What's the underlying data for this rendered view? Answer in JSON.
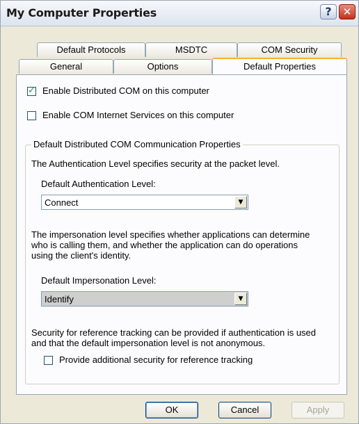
{
  "window": {
    "title": "My Computer Properties",
    "help_glyph": "?",
    "close_glyph": "✕"
  },
  "tabs_back": [
    {
      "label": "Default Protocols"
    },
    {
      "label": "MSDTC"
    },
    {
      "label": "COM Security"
    }
  ],
  "tabs_front": [
    {
      "label": "General"
    },
    {
      "label": "Options"
    },
    {
      "label": "Default Properties",
      "active": true
    }
  ],
  "panel": {
    "enable_dcom": {
      "label": "Enable Distributed COM on this computer",
      "checked": true
    },
    "enable_cis": {
      "label": "Enable COM Internet Services on this computer",
      "checked": false
    },
    "group": {
      "legend": "Default Distributed COM Communication Properties",
      "auth_desc": "The Authentication Level specifies security at the packet level.",
      "auth_label": "Default Authentication Level:",
      "auth_value": "Connect",
      "imp_desc_1": "The impersonation level specifies whether applications can determine",
      "imp_desc_2": "who is calling them, and whether the application can do operations",
      "imp_desc_3": "using the client's identity.",
      "imp_label": "Default Impersonation Level:",
      "imp_value": "Identify",
      "ref_desc_1": "Security for reference tracking can be provided if authentication is used",
      "ref_desc_2": "and that the default impersonation level is not anonymous.",
      "ref_check": {
        "label": "Provide additional security for reference tracking",
        "checked": false
      }
    }
  },
  "buttons": {
    "ok": "OK",
    "cancel": "Cancel",
    "apply": "Apply"
  },
  "colors": {
    "accent_tab": "#f7b035",
    "check_mark": "#21a121",
    "dialog_bg": "#ece9d8"
  }
}
